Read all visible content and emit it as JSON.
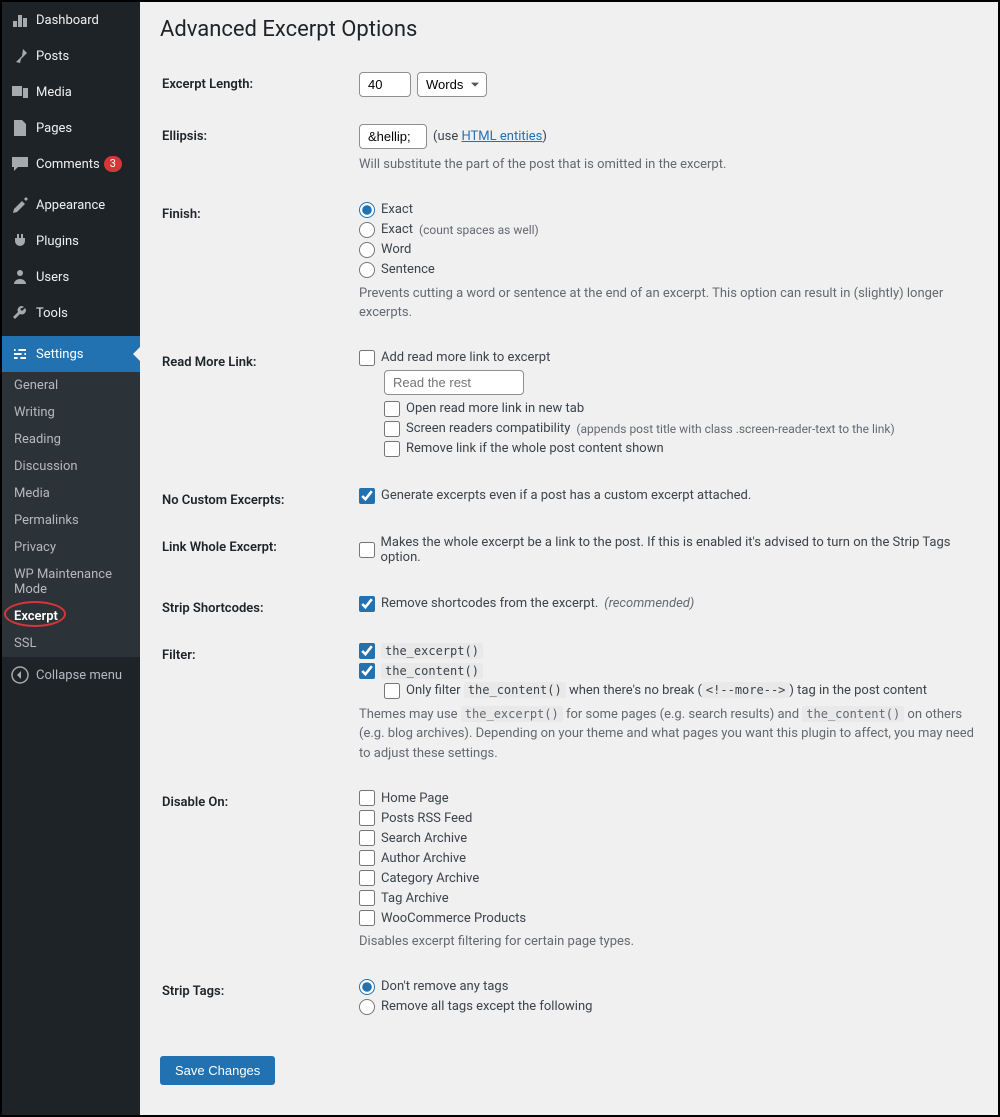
{
  "sidebar": {
    "dashboard": "Dashboard",
    "posts": "Posts",
    "media": "Media",
    "pages": "Pages",
    "comments": "Comments",
    "comments_count": "3",
    "appearance": "Appearance",
    "plugins": "Plugins",
    "users": "Users",
    "tools": "Tools",
    "settings": "Settings",
    "collapse": "Collapse menu"
  },
  "submenu": [
    "General",
    "Writing",
    "Reading",
    "Discussion",
    "Media",
    "Permalinks",
    "Privacy",
    "WP Maintenance Mode",
    "Excerpt",
    "SSL"
  ],
  "page": {
    "title": "Advanced Excerpt Options"
  },
  "excerpt_length": {
    "label": "Excerpt Length:",
    "value": "40",
    "unit": "Words"
  },
  "ellipsis": {
    "label": "Ellipsis:",
    "value": "&hellip;",
    "hint_pre": "(use ",
    "hint_link": "HTML entities",
    "hint_post": ")",
    "desc": "Will substitute the part of the post that is omitted in the excerpt."
  },
  "finish": {
    "label": "Finish:",
    "opt1": "Exact",
    "opt2": "Exact",
    "opt2_sub": "(count spaces as well)",
    "opt3": "Word",
    "opt4": "Sentence",
    "desc": "Prevents cutting a word or sentence at the end of an excerpt. This option can result in (slightly) longer excerpts."
  },
  "read_more": {
    "label": "Read More Link:",
    "add": "Add read more link to excerpt",
    "placeholder": "Read the rest",
    "newtab": "Open read more link in new tab",
    "sr": "Screen readers compatibility",
    "sr_sub": "(appends post title with class .screen-reader-text to the link)",
    "remove": "Remove link if the whole post content shown"
  },
  "no_custom": {
    "label": "No Custom Excerpts:",
    "text": "Generate excerpts even if a post has a custom excerpt attached."
  },
  "link_whole": {
    "label": "Link Whole Excerpt:",
    "text": "Makes the whole excerpt be a link to the post. If this is enabled it's advised to turn on the Strip Tags option."
  },
  "strip_shortcodes": {
    "label": "Strip Shortcodes:",
    "text": "Remove shortcodes from the excerpt.",
    "rec": "(recommended)"
  },
  "filter": {
    "label": "Filter:",
    "ex": "the_excerpt()",
    "ct": "the_content()",
    "only_pre": "Only filter",
    "only_code": "the_content()",
    "only_mid": "when there's no break (",
    "only_code2": "<!--more-->",
    "only_post": ") tag in the post content",
    "desc_pre": "Themes may use ",
    "desc_c1": "the_excerpt()",
    "desc_mid": " for some pages (e.g. search results) and ",
    "desc_c2": "the_content()",
    "desc_post": " on others (e.g. blog archives). Depending on your theme and what pages you want this plugin to affect, you may need to adjust these settings."
  },
  "disable_on": {
    "label": "Disable On:",
    "opts": [
      "Home Page",
      "Posts RSS Feed",
      "Search Archive",
      "Author Archive",
      "Category Archive",
      "Tag Archive",
      "WooCommerce Products"
    ],
    "desc": "Disables excerpt filtering for certain page types."
  },
  "strip_tags": {
    "label": "Strip Tags:",
    "opt1": "Don't remove any tags",
    "opt2": "Remove all tags except the following"
  },
  "save": "Save Changes"
}
